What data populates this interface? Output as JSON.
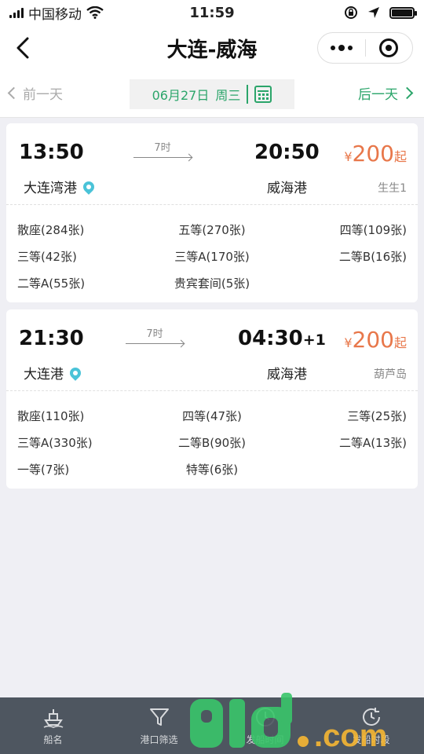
{
  "status_bar": {
    "carrier": "中国移动",
    "time": "11:59"
  },
  "nav": {
    "title": "大连-威海"
  },
  "date_bar": {
    "prev_label": "前一天",
    "next_label": "后一天",
    "date": "06月27日",
    "weekday": "周三"
  },
  "trips": [
    {
      "depart_time": "13:50",
      "arrive_time": "20:50",
      "next_day": "",
      "duration": "7时",
      "price_symbol": "¥",
      "price": "200",
      "price_suffix": "起",
      "depart_port": "大连湾港",
      "arrive_port": "威海港",
      "ship": "生生1",
      "seats": [
        [
          "散座(284张)",
          "五等(270张)",
          "四等(109张)"
        ],
        [
          "三等(42张)",
          "三等A(170张)",
          "二等B(16张)"
        ],
        [
          "二等A(55张)",
          "贵宾套间(5张)",
          ""
        ]
      ]
    },
    {
      "depart_time": "21:30",
      "arrive_time": "04:30",
      "next_day": "+1",
      "duration": "7时",
      "price_symbol": "¥",
      "price": "200",
      "price_suffix": "起",
      "depart_port": "大连港",
      "arrive_port": "威海港",
      "ship": "葫芦岛",
      "seats": [
        [
          "散座(110张)",
          "四等(47张)",
          "三等(25张)"
        ],
        [
          "三等A(330张)",
          "二等B(90张)",
          "二等A(13张)"
        ],
        [
          "一等(7张)",
          "特等(6张)",
          ""
        ]
      ]
    }
  ],
  "tabs": [
    {
      "label": "船名",
      "icon": "ship-icon"
    },
    {
      "label": "港口筛选",
      "icon": "filter-icon"
    },
    {
      "label": "发船时间",
      "icon": "clock-icon"
    },
    {
      "label": "发船时段",
      "icon": "time-range-icon"
    }
  ],
  "colors": {
    "accent": "#2ba56a",
    "price": "#e8774a",
    "tab_bg": "#4e5660",
    "pin": "#4ac3d8"
  },
  "watermark": {
    "text": "91.com"
  }
}
